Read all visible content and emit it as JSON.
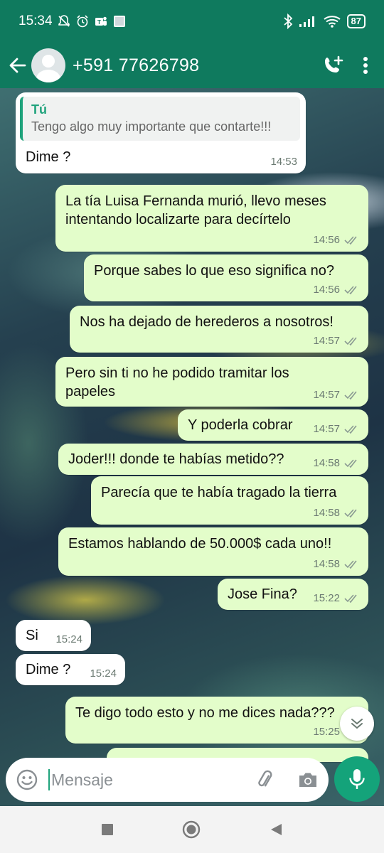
{
  "status_bar": {
    "time": "15:34",
    "battery": "87"
  },
  "header": {
    "contact_name": "+591 77626798",
    "back_icon": "arrow-left-icon",
    "add_call_icon": "phone-plus-icon",
    "menu_icon": "more-vert-icon"
  },
  "messages": [
    {
      "dir": "in",
      "quote_name": "Tú",
      "quote_text": "Tengo algo muy importante que contarte!!!",
      "text": "Dime ?",
      "time": "14:53"
    },
    {
      "dir": "out",
      "text": "La tía Luisa Fernanda murió, llevo meses intentando localizarte para decírtelo",
      "time": "14:56"
    },
    {
      "dir": "out",
      "text": "Porque sabes lo que eso significa no?",
      "time": "14:56"
    },
    {
      "dir": "out",
      "text": "Nos ha dejado de herederos a nosotros!",
      "time": "14:57"
    },
    {
      "dir": "out",
      "text": "Pero sin ti no he podido tramitar los papeles",
      "time": "14:57"
    },
    {
      "dir": "out",
      "text": "Y poderla cobrar",
      "time": "14:57"
    },
    {
      "dir": "out",
      "text": "Joder!!! donde te habías metido??",
      "time": "14:58"
    },
    {
      "dir": "out",
      "text": "Parecía que te había tragado la tierra",
      "time": "14:58"
    },
    {
      "dir": "out",
      "text": "Estamos hablando de 50.000$ cada uno!!",
      "time": "14:58"
    },
    {
      "dir": "out",
      "text": "Jose Fina?",
      "time": "15:22"
    },
    {
      "dir": "in",
      "text": "Si",
      "time": "15:24"
    },
    {
      "dir": "in",
      "text": "Dime ?",
      "time": "15:24"
    },
    {
      "dir": "out",
      "text": "Te digo todo esto y no me dices nada???",
      "time": "15:25"
    }
  ],
  "composer": {
    "placeholder": "Mensaje"
  },
  "colors": {
    "header": "#0f7a5e",
    "outgoing_bubble": "#e3fdca",
    "incoming_bubble": "#ffffff",
    "accent": "#14a37a"
  }
}
